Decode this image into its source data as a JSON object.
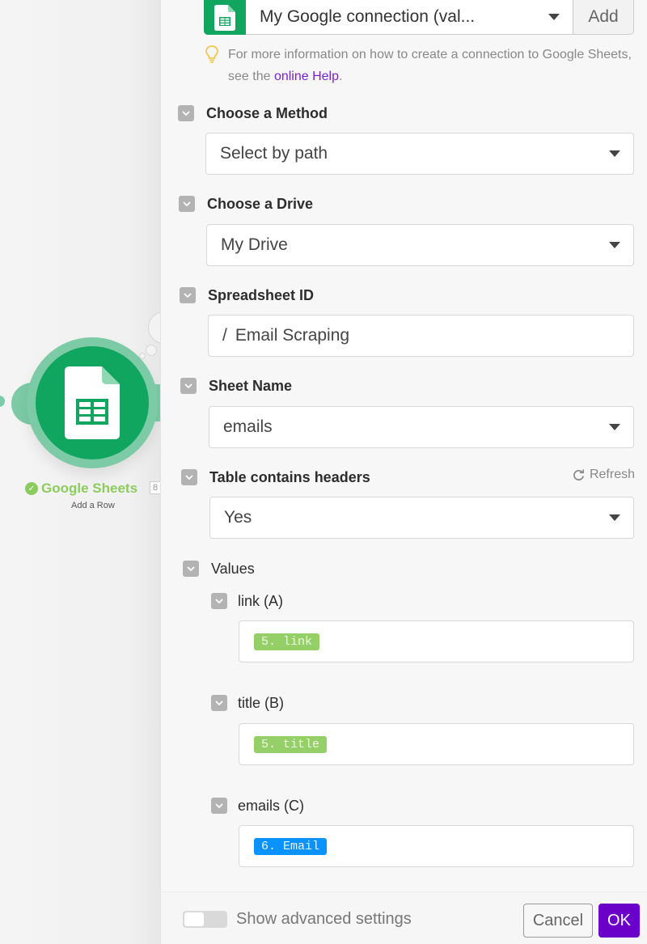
{
  "canvas": {
    "node": {
      "app_name": "Google Sheets",
      "action": "Add a Row",
      "count_badge": "8",
      "status_icon": "check-circle-icon",
      "icon": "spreadsheet-icon",
      "color": "#11a660"
    }
  },
  "panel": {
    "connection": {
      "icon": "spreadsheet-icon",
      "selected": "My Google connection (val...",
      "add_label": "Add"
    },
    "hint": {
      "icon": "lightbulb-icon",
      "text": "For more information on how to create a connection to Google Sheets, see the ",
      "link_text": "online Help",
      "suffix": "."
    },
    "fields": [
      {
        "label": "Choose a Method",
        "value": "Select by path",
        "type": "select"
      },
      {
        "label": "Choose a Drive",
        "value": "My Drive",
        "type": "select"
      },
      {
        "label": "Spreadsheet ID",
        "value": "Email Scraping",
        "prefix": "/",
        "type": "path"
      },
      {
        "label": "Sheet Name",
        "value": "emails",
        "type": "select"
      },
      {
        "label": "Table contains headers",
        "value": "Yes",
        "type": "select",
        "action": "Refresh"
      }
    ],
    "values": {
      "label": "Values",
      "columns": [
        {
          "label": "link (A)",
          "token": "5. link",
          "token_color": "#94d067"
        },
        {
          "label": "title (B)",
          "token": "5. title",
          "token_color": "#94d067"
        },
        {
          "label": "emails (C)",
          "token": "6. Email",
          "token_color": "#0a92ff"
        }
      ]
    },
    "footer": {
      "advanced_label": "Show advanced settings",
      "advanced_enabled": false,
      "cancel_label": "Cancel",
      "ok_label": "OK",
      "ok_color": "#6b00c9"
    }
  }
}
